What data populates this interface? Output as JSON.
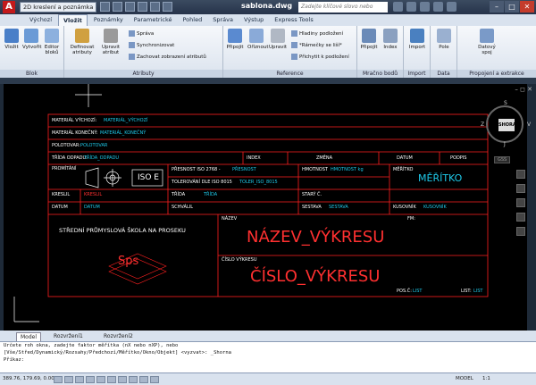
{
  "titlebar": {
    "app_logo": "A",
    "workspace": "2D kreslení a poznámka",
    "document": "sablona.dwg",
    "search_placeholder": "Zadejte klíčové slovo nebo výraz"
  },
  "tabs": [
    "Výchozí",
    "Vložit",
    "Poznámky",
    "Parametrické",
    "Pohled",
    "Správa",
    "Výstup",
    "Express Tools"
  ],
  "active_tab": "Vložit",
  "ribbon": {
    "blok": {
      "label": "Blok",
      "buttons": [
        "Vložit",
        "Vytvořit",
        "Editor bloků"
      ]
    },
    "atributy": {
      "label": "Atributy",
      "buttons": [
        "Definovat atributy",
        "Upravit atribut"
      ],
      "small": [
        "Správa",
        "Synchronizovat",
        "Zachovat zobrazení atributů"
      ]
    },
    "reference": {
      "label": "Reference",
      "buttons": [
        "Připojit",
        "Oříznout",
        "Upravit"
      ],
      "small": [
        "Hladiny podložení",
        "*Rámečky se liší*",
        "Přichytit k podložení"
      ]
    },
    "mracno": {
      "label": "Mračno bodů",
      "buttons": [
        "Připojit",
        "Index"
      ]
    },
    "import": {
      "label": "Import",
      "buttons": [
        "Import"
      ]
    },
    "data": {
      "label": "Data",
      "buttons": [
        "Pole"
      ]
    },
    "propojeni": {
      "label": "Propojení a extrakce",
      "buttons": [
        "Datový spoj"
      ]
    }
  },
  "viewcube": {
    "face": "SHORA",
    "north": "S",
    "south": "J",
    "west": "Z",
    "east": "V",
    "wcs": "GSS"
  },
  "title_block": {
    "material_label": "MATERIÁL VÝCHOZÍ:",
    "material_value": "MATERIÁL_VÝCHOZÍ",
    "material_final_label": "MATERIÁL KONEČNÝ:",
    "material_final_value": "MATERIÁL_KONEČNÝ",
    "surface_label": "POLOTOVAR:",
    "surface_value": "POLOTOVAR",
    "class_label": "TŘÍDA ODPADU:",
    "class_value": "TŘÍDA_ODPADU",
    "index_label": "INDEX",
    "change_label": "ZMĚNA",
    "date_label": "DATUM",
    "signature_label": "PODPIS",
    "projection_label": "PROMÍTÁNÍ",
    "iso_label": "ISO E",
    "accuracy_label": "PŘESNOST ISO 2768 -",
    "accuracy_value": "PŘESNOST",
    "tolerance_label": "TOLEROVÁNÍ DLE ISO 8015",
    "tolerance_value": "TOLER_ISO_8015",
    "weight_label": "HMOTNOST",
    "weight_value": "HMOTNOST  kg",
    "scale_label": "MĚŘÍTKO",
    "scale_value": "MĚŘÍTKO",
    "drew_label": "KRESLIL",
    "drew_value": "KRESLIL",
    "class2_label": "TŘÍDA",
    "class2_value": "TŘÍDA",
    "old_number_label": "STARÝ Č.",
    "date2_label": "DATUM",
    "date2_value": "DATUM",
    "approved_label": "SCHVÁLIL",
    "assembly_label": "SESTAVA",
    "assembly_value": "SESTAVA",
    "pieces_label": "KUSOVNÍK",
    "pieces_value": "KUSOVNÍK",
    "school": "STŘEDNÍ PRŮMYSLOVÁ ŠKOLA NA PROSEKU",
    "logo": "Sps",
    "name_label": "NÁZEV",
    "name_value": "NÁZEV_VÝKRESU",
    "format_label": "FM:",
    "number_label": "ČÍSLO VÝKRESU",
    "number_value": "ČÍSLO_VÝKRESU",
    "pos_label": "POS.Č:",
    "pos_value": "LIST",
    "sheet_label": "LIST:",
    "sheet_value": "LIST"
  },
  "layout_tabs": [
    "Model",
    "Rozvržení1",
    "Rozvržení2"
  ],
  "active_layout": "Model",
  "command_lines": [
    "Určete roh okna, zadejte faktor měřítka (nX nebo nXP), nebo",
    "[Vše/Střed/Dynamický/Rozsahy/Předchozí/Měřítko/Okno/Objekt] <vyzvat>: _Shorna",
    "Příkaz:"
  ],
  "status": {
    "coords": "389.76, 179.69, 0.00",
    "model": "MODEL",
    "scale": "1:1"
  }
}
